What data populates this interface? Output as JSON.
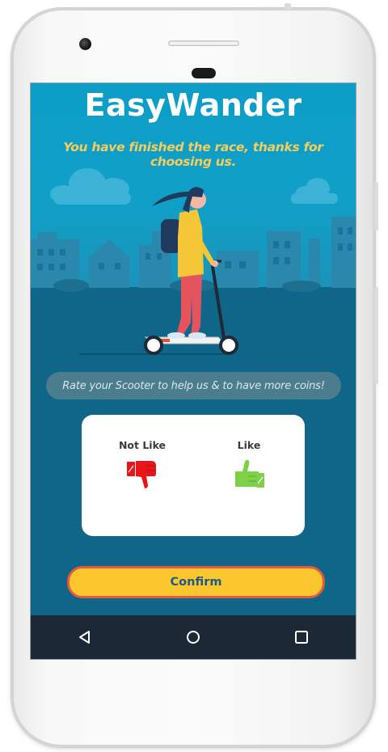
{
  "app": {
    "title": "EasyWander",
    "subtitle": "You have finished the race, thanks for choosing us."
  },
  "rating": {
    "prompt": "Rate your Scooter to help us & to have more coins!",
    "options": [
      {
        "label": "Not Like",
        "icon": "thumbs-down-icon",
        "color": "#e8151b"
      },
      {
        "label": "Like",
        "icon": "thumbs-up-icon",
        "color": "#7dd048"
      }
    ]
  },
  "confirm": {
    "label": "Confirm"
  },
  "navigation_bar": {
    "buttons": [
      {
        "icon": "back-triangle-icon"
      },
      {
        "icon": "home-circle-icon"
      },
      {
        "icon": "recents-square-icon"
      }
    ]
  },
  "colors": {
    "screen_background": "#0e6486",
    "sky": "#0c9ec8",
    "title_text": "#ffffff",
    "subtitle_text": "#f6cd5a",
    "confirm_fill": "#fcc62f",
    "confirm_border": "#e45a3c",
    "confirm_text": "#1e5a86",
    "nav_bar": "#1d2837"
  }
}
